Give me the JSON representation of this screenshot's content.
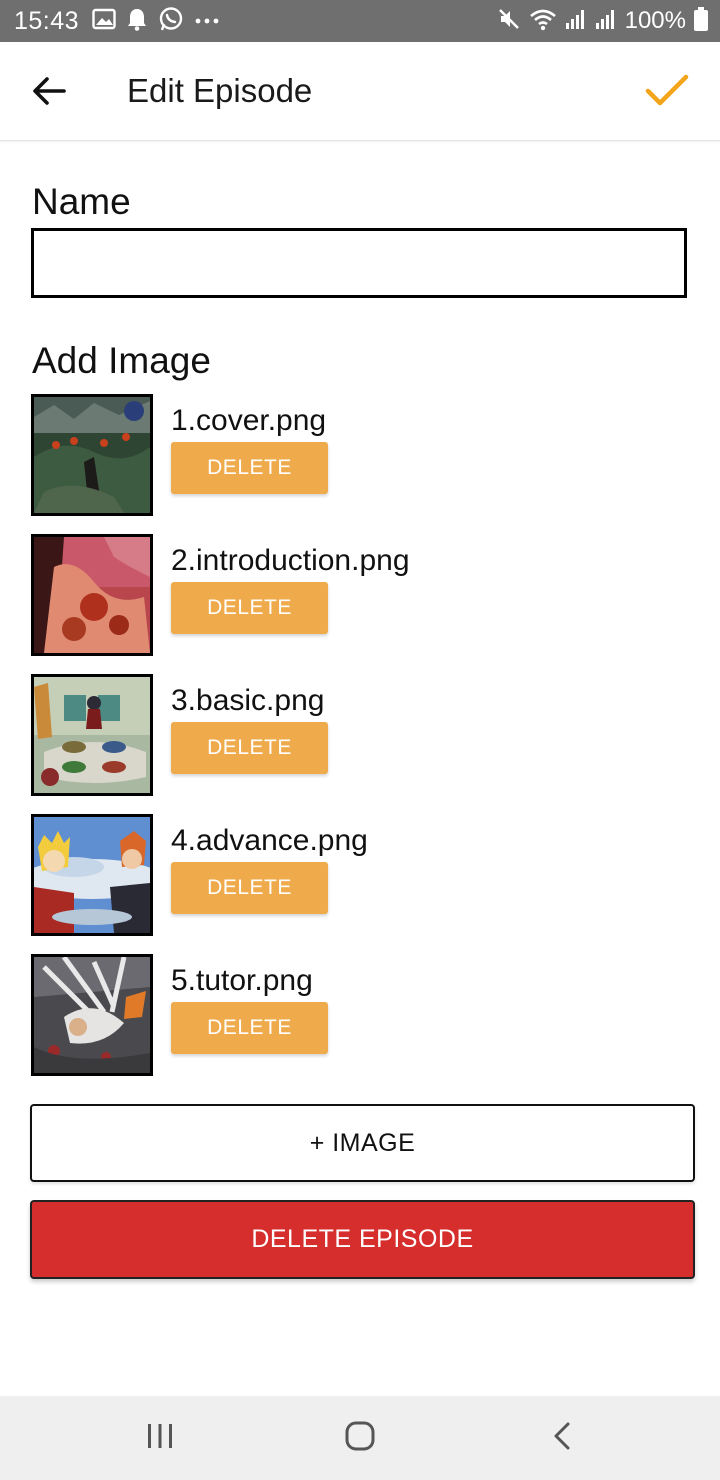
{
  "status_bar": {
    "time": "15:43",
    "battery_percent": "100%",
    "left_icons": [
      "image-icon",
      "bell-icon",
      "whatsapp-icon",
      "more-dots-icon"
    ],
    "right_icons": [
      "mute-icon",
      "wifi-icon",
      "signal-icon",
      "signal-icon",
      "battery-icon"
    ]
  },
  "app_bar": {
    "title": "Edit Episode",
    "back_icon": "arrow-left-icon",
    "confirm_icon": "checkmark-icon",
    "accent_color": "#f2a51a"
  },
  "form": {
    "name_label": "Name",
    "name_value": "",
    "add_image_label": "Add Image"
  },
  "images": [
    {
      "file_name": "1.cover.png",
      "delete_label": "DELETE"
    },
    {
      "file_name": "2.introduction.png",
      "delete_label": "DELETE"
    },
    {
      "file_name": "3.basic.png",
      "delete_label": "DELETE"
    },
    {
      "file_name": "4.advance.png",
      "delete_label": "DELETE"
    },
    {
      "file_name": "5.tutor.png",
      "delete_label": "DELETE"
    }
  ],
  "actions": {
    "add_image_label": "+ IMAGE",
    "delete_episode_label": "DELETE EPISODE",
    "delete_button_color": "#efab4b",
    "delete_episode_color": "#d62d2d"
  },
  "nav_bar": {
    "items": [
      "recent-apps-icon",
      "home-icon",
      "back-icon"
    ]
  }
}
